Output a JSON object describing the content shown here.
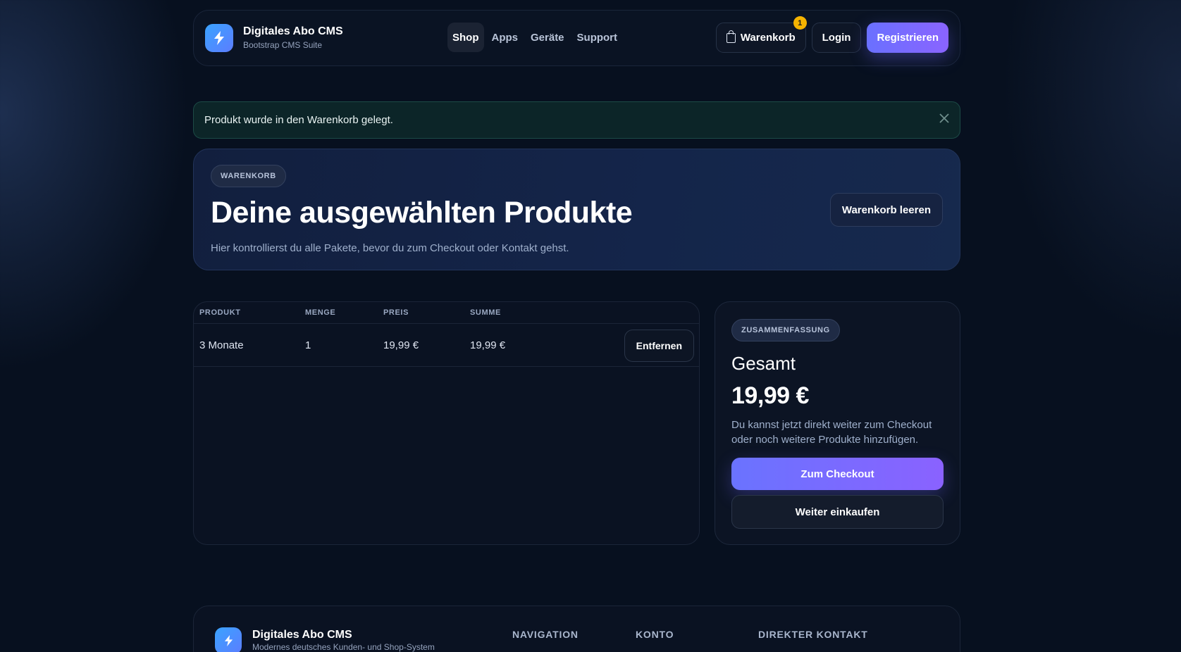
{
  "navbar": {
    "brand_title": "Digitales Abo CMS",
    "brand_subtitle": "Bootstrap CMS Suite",
    "brand_icon": "lightning-bolt-icon",
    "links": [
      "Shop",
      "Apps",
      "Geräte",
      "Support"
    ],
    "active_link": "Shop",
    "cart_label": "Warenkorb",
    "cart_count": "1",
    "login_label": "Login",
    "register_label": "Registrieren"
  },
  "alert": {
    "message": "Produkt wurde in den Warenkorb gelegt."
  },
  "hero": {
    "badge": "WARENKORB",
    "title": "Deine ausgewählten Produkte",
    "subtitle": "Hier kontrollierst du alle Pakete, bevor du zum Checkout oder Kontakt gehst.",
    "clear_button": "Warenkorb leeren"
  },
  "cart": {
    "columns": [
      "PRODUKT",
      "MENGE",
      "PREIS",
      "SUMME"
    ],
    "rows": [
      {
        "product": "3 Monate",
        "quantity": "1",
        "price": "19,99 €",
        "total": "19,99 €",
        "remove_label": "Entfernen"
      }
    ]
  },
  "summary": {
    "badge": "ZUSAMMENFASSUNG",
    "heading": "Gesamt",
    "total": "19,99 €",
    "text": "Du kannst jetzt direkt weiter zum Checkout oder noch weitere Produkte hinzufügen.",
    "checkout_button": "Zum Checkout",
    "continue_button": "Weiter einkaufen"
  },
  "footer": {
    "brand_title": "Digitales Abo CMS",
    "brand_subtitle": "Modernes deutsches Kunden- und Shop-System",
    "columns": [
      "NAVIGATION",
      "KONTO",
      "DIREKTER KONTAKT"
    ]
  },
  "colors": {
    "background": "#07101f",
    "accent": "#6a70ff",
    "badge": "#f5b301",
    "alert_bg": "#0c2528"
  }
}
